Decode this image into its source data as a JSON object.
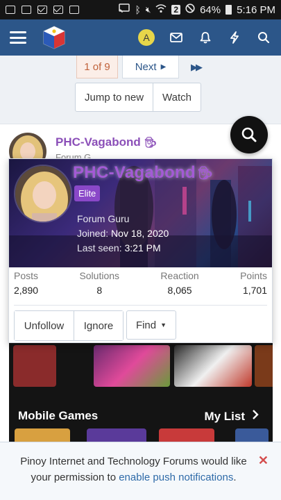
{
  "status_bar": {
    "battery": "64%",
    "time": "5:16 PM",
    "badge": "2"
  },
  "header": {
    "avatar_letter": "A"
  },
  "pagination": {
    "current": "1 of 9",
    "next_label": "Next"
  },
  "thread_actions": {
    "jump_label": "Jump to new",
    "watch_label": "Watch"
  },
  "post": {
    "username": "PHC-Vagabond",
    "subtitle": "Forum G..."
  },
  "member_card": {
    "username": "PHC-Vagabond",
    "badge": "Elite",
    "title": "Forum Guru",
    "joined_label": "Joined:",
    "joined_value": "Nov 18, 2020",
    "last_seen_label": "Last seen:",
    "last_seen_value": "3:21 PM",
    "stats": [
      {
        "label": "Posts",
        "value": "2,890"
      },
      {
        "label": "Solutions",
        "value": "8"
      },
      {
        "label": "Reaction",
        "value": "8,065"
      },
      {
        "label": "Points",
        "value": "1,701"
      }
    ],
    "unfollow_label": "Unfollow",
    "ignore_label": "Ignore",
    "find_label": "Find"
  },
  "media": {
    "section_title": "Mobile Games",
    "my_list_label": "My List"
  },
  "notice": {
    "text_before": "Pinoy Internet and Technology Forums would like your permission to ",
    "link_text": "enable push notifications",
    "text_after": "."
  },
  "colors": {
    "header_bg": "#2c5689",
    "username_purple": "#8b4fb8",
    "elite_badge": "#8a48c8",
    "link_blue": "#2e6aa8"
  }
}
